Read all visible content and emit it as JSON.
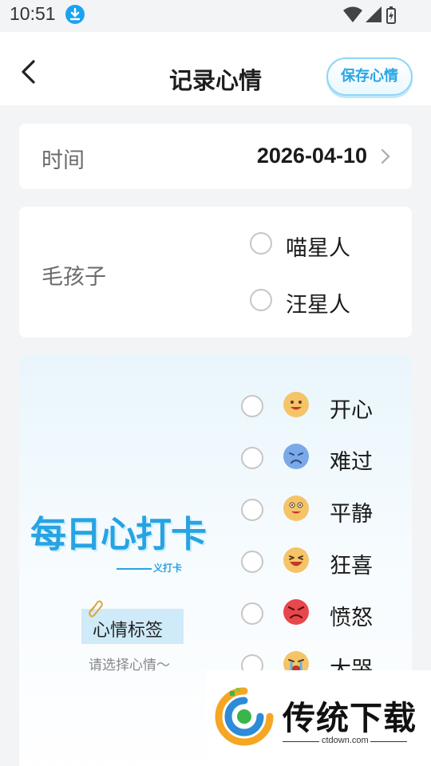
{
  "status_bar": {
    "time": "10:51"
  },
  "header": {
    "title": "记录心情",
    "save_label": "保存心情"
  },
  "date_row": {
    "label": "时间",
    "value": "2026-04-10"
  },
  "pet_row": {
    "label": "毛孩子",
    "options": [
      {
        "label": "喵星人",
        "selected": false
      },
      {
        "label": "汪星人",
        "selected": false
      }
    ]
  },
  "mood": {
    "brand_title": "每日心打卡",
    "brand_sub": "义打卡",
    "tag_label": "心情标签",
    "hint": "请选择心情～",
    "options": [
      {
        "label": "开心",
        "emoji": "happy-face",
        "selected": false
      },
      {
        "label": "难过",
        "emoji": "sad-face",
        "selected": false
      },
      {
        "label": "平静",
        "emoji": "calm-face",
        "selected": false
      },
      {
        "label": "狂喜",
        "emoji": "ecstatic-face",
        "selected": false
      },
      {
        "label": "愤怒",
        "emoji": "angry-face",
        "selected": false
      },
      {
        "label": "大哭",
        "emoji": "crying-face",
        "selected": false
      }
    ]
  },
  "watermark": {
    "name": "传统下载",
    "url": "ctdown.com"
  },
  "colors": {
    "accent": "#27a3e2",
    "background": "#f3f4f6",
    "card": "#ffffff"
  }
}
